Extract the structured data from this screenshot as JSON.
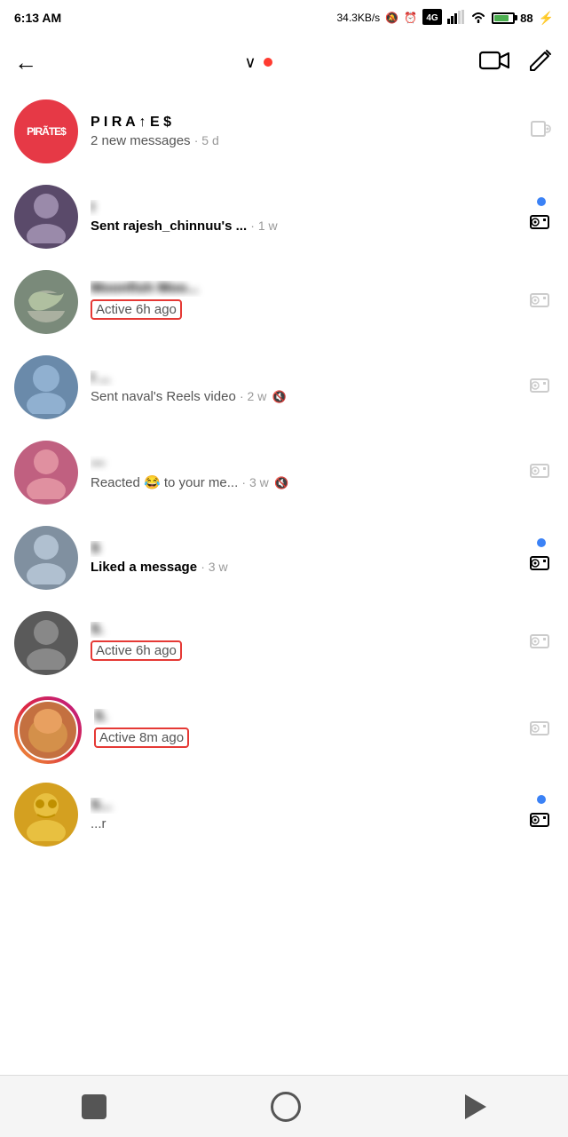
{
  "statusBar": {
    "time": "6:13 AM",
    "wifi": "wifi",
    "networkSpeed": "34.3KB/s",
    "muteIcon": "🔕",
    "alarmIcon": "⏰",
    "teIcon": "TE",
    "signal": "signal",
    "signal2": "wifi",
    "batteryPercent": "88"
  },
  "nav": {
    "backLabel": "←",
    "dropdownArrow": "∨",
    "redDotVisible": true,
    "videoLabel": "video-camera",
    "editLabel": "edit"
  },
  "conversations": [
    {
      "id": "conv-1",
      "avatarType": "pirates",
      "avatarLabel": "PIRATES",
      "nameBlurred": false,
      "name": "P I R A ↑ E $",
      "sub": "2 new messages · 5 d",
      "subBold": false,
      "hasDot": false,
      "cameraActive": true,
      "muteActive": false,
      "activeHighlight": false
    },
    {
      "id": "conv-2",
      "avatarType": "color",
      "avatarColor": "#5a4a6a",
      "nameBlurred": true,
      "name": "I",
      "sub": "Sent rajesh_chinnuu's ...",
      "subTime": "1 w",
      "subBold": true,
      "hasDot": true,
      "cameraActive": true,
      "muteActive": false,
      "activeHighlight": false
    },
    {
      "id": "conv-3",
      "avatarType": "color",
      "avatarColor": "#7a8a7a",
      "nameBlurred": true,
      "name": "Moonfish Moo...",
      "sub": "Active 6h ago",
      "subBold": false,
      "hasDot": false,
      "cameraActive": false,
      "muteActive": false,
      "activeHighlight": true
    },
    {
      "id": "conv-4",
      "avatarType": "color",
      "avatarColor": "#6a8aaa",
      "nameBlurred": true,
      "name": "I ...",
      "sub": "Sent naval's Reels video · 2 w",
      "subBold": false,
      "hasDot": false,
      "cameraActive": false,
      "muteActive": true,
      "activeHighlight": false
    },
    {
      "id": "conv-5",
      "avatarType": "color",
      "avatarColor": "#c06080",
      "nameBlurred": true,
      "name": "—",
      "sub": "Reacted 😂 to your me... · 3 w",
      "subBold": false,
      "hasDot": false,
      "cameraActive": false,
      "muteActive": true,
      "activeHighlight": false
    },
    {
      "id": "conv-6",
      "avatarType": "color",
      "avatarColor": "#8090a0",
      "nameBlurred": true,
      "name": "S",
      "sub": "Liked a message · 3 w",
      "subBold": true,
      "hasDot": true,
      "cameraActive": true,
      "muteActive": false,
      "activeHighlight": false
    },
    {
      "id": "conv-7",
      "avatarType": "color",
      "avatarColor": "#5a5a5a",
      "nameBlurred": true,
      "name": "S.",
      "sub": "Active 6h ago",
      "subBold": false,
      "hasDot": false,
      "cameraActive": false,
      "muteActive": false,
      "activeHighlight": true
    },
    {
      "id": "conv-8",
      "avatarType": "color",
      "avatarColor": "#c47040",
      "nameBlurred": true,
      "name": "S.",
      "sub": "Active 8m ago",
      "subBold": false,
      "hasDot": false,
      "cameraActive": false,
      "muteActive": false,
      "activeHighlight": true,
      "storyRing": true
    },
    {
      "id": "conv-9",
      "avatarType": "color",
      "avatarColor": "#d4a020",
      "nameBlurred": true,
      "name": "S...",
      "sub": "...r",
      "subBold": false,
      "hasDot": true,
      "cameraActive": true,
      "muteActive": false,
      "activeHighlight": false,
      "partial": true
    }
  ],
  "bottomNav": {
    "square": "■",
    "circle": "○",
    "back": "◀"
  }
}
